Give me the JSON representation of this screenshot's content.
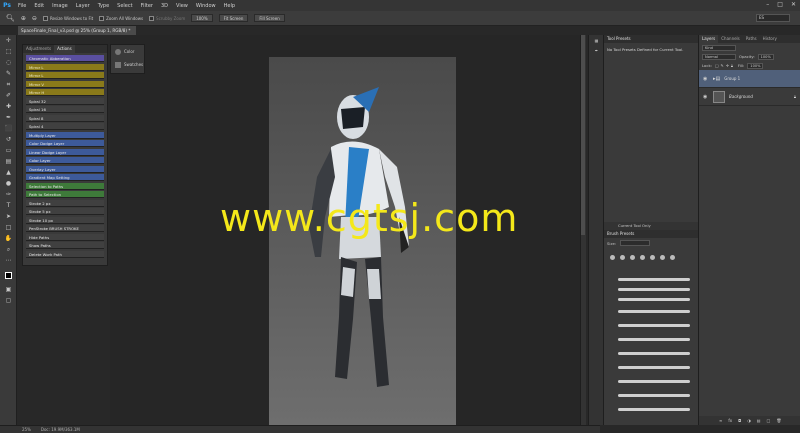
{
  "app": {
    "logo": "Ps",
    "menu": [
      "File",
      "Edit",
      "Image",
      "Layer",
      "Type",
      "Select",
      "Filter",
      "3D",
      "View",
      "Window",
      "Help"
    ],
    "window_controls": [
      "–",
      "□",
      "✕"
    ]
  },
  "options_bar": {
    "resize_windows": "Resize Windows to Fit",
    "zoom_all": "Zoom All Windows",
    "scrubby_zoom": "Scrubby Zoom",
    "btn_100": "100%",
    "btn_fit": "Fit Screen",
    "btn_fill": "Fill Screen",
    "search_value": "ES"
  },
  "document": {
    "tab_title": "SpaceFinale_Final_v3.psd @ 25% (Group 1, RGB/8) *"
  },
  "actions_panel": {
    "tabs": [
      "Adjustments",
      "Actions"
    ],
    "items": [
      {
        "label": "Chromatic Abberation",
        "color": "violet"
      },
      {
        "label": "Mirror L",
        "color": "olive"
      },
      {
        "label": "Mirror L",
        "color": "olive"
      },
      {
        "label": "Mirror V",
        "color": "olive"
      },
      {
        "label": "Mirror H",
        "color": "olive"
      },
      {
        "label": "Spiral 32",
        "color": "grey"
      },
      {
        "label": "Spiral 16",
        "color": "grey"
      },
      {
        "label": "Spiral 8",
        "color": "grey"
      },
      {
        "label": "Spiral 4",
        "color": "grey"
      },
      {
        "label": "Multiply Layer",
        "color": "blue"
      },
      {
        "label": "Color Dodge Layer",
        "color": "blue"
      },
      {
        "label": "Linear Dodge Layer",
        "color": "blue"
      },
      {
        "label": "Color Layer",
        "color": "blue"
      },
      {
        "label": "Overlay Layer",
        "color": "blue"
      },
      {
        "label": "Gradient Map Setting",
        "color": "blue"
      },
      {
        "label": "Selection to Paths",
        "color": "green"
      },
      {
        "label": "Path to Selection",
        "color": "green"
      },
      {
        "label": "Stroke 2 px",
        "color": "grey"
      },
      {
        "label": "Stroke 5 px",
        "color": "grey"
      },
      {
        "label": "Stroke 10 px",
        "color": "grey"
      },
      {
        "label": "PenStroke BRUSH STROKE",
        "color": "grey"
      },
      {
        "label": "Hide Paths",
        "color": "grey"
      },
      {
        "label": "Show Paths",
        "color": "grey"
      },
      {
        "label": "Delete Work Path",
        "color": "grey"
      }
    ]
  },
  "color_swatches": {
    "items": [
      "Color",
      "Swatches"
    ]
  },
  "status_bar": {
    "zoom": "25%",
    "doc": "Doc: 19.9M/363.1M"
  },
  "tool_presets": {
    "title": "Tool Presets",
    "message": "No Tool Presets Defined for Current Tool.",
    "current_tool_only": "Current Tool Only"
  },
  "brush_presets": {
    "title": "Brush Presets",
    "size_label": "Size:"
  },
  "layers_panel": {
    "tabs": [
      "Layers",
      "Channels",
      "Paths",
      "History"
    ],
    "kind": "Kind",
    "blend_mode": "Normal",
    "opacity_label": "Opacity:",
    "opacity_value": "100%",
    "lock_label": "Lock:",
    "fill_label": "Fill:",
    "fill_value": "100%",
    "layers": [
      {
        "name": "Group 1",
        "selected": true
      },
      {
        "name": "Background",
        "selected": false
      }
    ]
  },
  "overlay": {
    "watermark": "www.cgtsj.com"
  }
}
